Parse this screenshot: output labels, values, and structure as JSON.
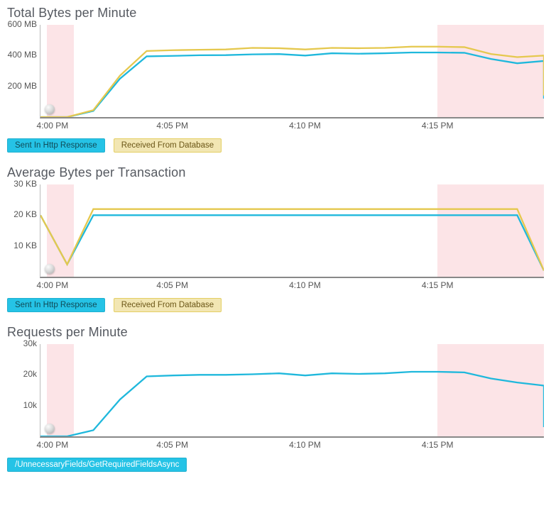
{
  "colors": {
    "series_blue": "#1fb8dc",
    "series_gold": "#e5c84e",
    "band": "#fce4e7"
  },
  "x_ticks": [
    {
      "label": "4:00 PM",
      "frac": 0.0
    },
    {
      "label": "4:05 PM",
      "frac": 0.263
    },
    {
      "label": "4:10 PM",
      "frac": 0.526
    },
    {
      "label": "4:15 PM",
      "frac": 0.789
    }
  ],
  "bands": [
    {
      "start": 0.013,
      "end": 0.066
    },
    {
      "start": 0.789,
      "end": 1.0
    }
  ],
  "chart_data": [
    {
      "id": "total_bytes",
      "type": "line",
      "title": "Total Bytes per Minute",
      "ylabel": "",
      "ylim": [
        0,
        600
      ],
      "y_unit": " MB",
      "y_ticks": [
        0,
        200,
        400,
        600
      ],
      "x": [
        0.0,
        0.053,
        0.105,
        0.158,
        0.211,
        0.263,
        0.316,
        0.368,
        0.421,
        0.474,
        0.526,
        0.579,
        0.632,
        0.684,
        0.737,
        0.789,
        0.842,
        0.895,
        0.947,
        1.0
      ],
      "series": [
        {
          "name": "Sent In Http Response",
          "color": "blue",
          "values": [
            0,
            0,
            40,
            250,
            395,
            398,
            402,
            403,
            408,
            410,
            400,
            415,
            412,
            415,
            420,
            420,
            418,
            378,
            350,
            365,
            120
          ]
        },
        {
          "name": "Received From Database",
          "color": "gold",
          "values": [
            0,
            0,
            45,
            270,
            430,
            435,
            438,
            440,
            450,
            448,
            440,
            450,
            448,
            450,
            458,
            458,
            455,
            410,
            390,
            400,
            140
          ]
        }
      ],
      "legend": [
        {
          "text": "Sent In Http Response",
          "style": "blue"
        },
        {
          "text": "Received From Database",
          "style": "gold"
        }
      ]
    },
    {
      "id": "avg_bytes",
      "type": "line",
      "title": "Average Bytes per Transaction",
      "ylabel": "",
      "ylim": [
        0,
        30
      ],
      "y_unit": " KB",
      "y_ticks": [
        0,
        10,
        20,
        30
      ],
      "x": [
        0.0,
        0.053,
        0.105,
        0.947,
        1.0
      ],
      "series": [
        {
          "name": "Sent In Http Response",
          "color": "blue",
          "values": [
            20,
            4,
            20,
            20,
            2
          ]
        },
        {
          "name": "Received From Database",
          "color": "gold",
          "values": [
            20,
            4,
            22,
            22,
            2
          ]
        }
      ],
      "legend": [
        {
          "text": "Sent In Http Response",
          "style": "blue"
        },
        {
          "text": "Received From Database",
          "style": "gold"
        }
      ]
    },
    {
      "id": "requests",
      "type": "line",
      "title": "Requests per Minute",
      "ylabel": "",
      "ylim": [
        0,
        30
      ],
      "y_unit": "k",
      "y_ticks": [
        0,
        10,
        20,
        30
      ],
      "x": [
        0.0,
        0.053,
        0.105,
        0.158,
        0.211,
        0.263,
        0.316,
        0.368,
        0.421,
        0.474,
        0.526,
        0.579,
        0.632,
        0.684,
        0.737,
        0.789,
        0.842,
        0.895,
        0.947,
        1.0
      ],
      "series": [
        {
          "name": "/UnnecessaryFields/GetRequiredFieldsAsync",
          "color": "blue",
          "values": [
            0,
            0,
            2,
            12,
            19.5,
            19.8,
            20,
            20,
            20.2,
            20.5,
            19.8,
            20.5,
            20.3,
            20.5,
            21,
            21,
            20.8,
            18.8,
            17.5,
            16.5,
            3
          ]
        }
      ],
      "legend": [
        {
          "text": "/UnnecessaryFields/GetRequiredFieldsAsync",
          "style": "blue-solid"
        }
      ]
    }
  ]
}
